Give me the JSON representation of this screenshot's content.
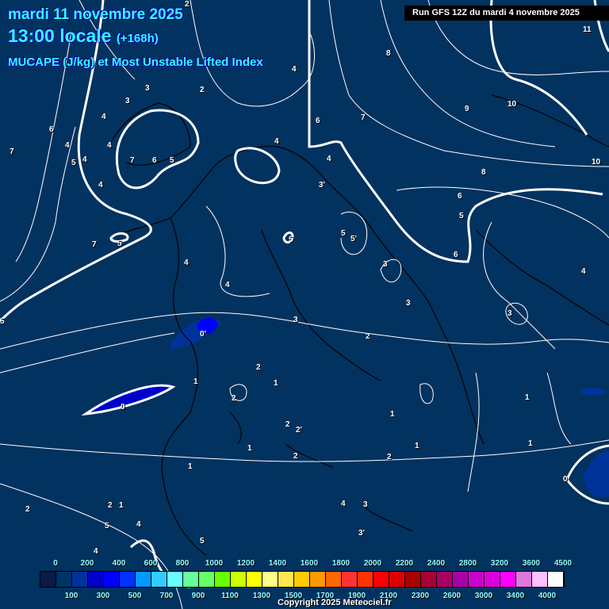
{
  "header": {
    "date": "mardi 11 novembre 2025",
    "time": "13:00 locale",
    "lead": "(+168h)",
    "parameter": "MUCAPE (J/kg) et Most Unstable Lifted Index",
    "run": "Run GFS 12Z du mardi 4 novembre 2025"
  },
  "legend": {
    "top_labels": [
      "0",
      "200",
      "400",
      "600",
      "800",
      "1000",
      "1200",
      "1400",
      "1600",
      "1800",
      "2000",
      "2200",
      "2400",
      "2800",
      "3200",
      "3600",
      "4500"
    ],
    "bottom_labels": [
      "100",
      "300",
      "500",
      "700",
      "900",
      "1100",
      "1300",
      "1500",
      "1700",
      "1900",
      "2100",
      "2300",
      "2600",
      "3000",
      "3400",
      "4000"
    ],
    "colors": [
      "#0a1a44",
      "#003366",
      "#003399",
      "#0000cc",
      "#0000ff",
      "#0033ff",
      "#0099ff",
      "#33ccff",
      "#66ffff",
      "#66ff99",
      "#66ff66",
      "#66ff00",
      "#ccff00",
      "#ffff00",
      "#ffff88",
      "#ffe64d",
      "#ffcc00",
      "#ff9900",
      "#ff6600",
      "#ff3333",
      "#ff3300",
      "#ff0000",
      "#dd0000",
      "#aa0000",
      "#aa0033",
      "#aa0066",
      "#aa00aa",
      "#cc00cc",
      "#dd00dd",
      "#ff00ff",
      "#dd77dd",
      "#ffc0ff",
      "#ffffff"
    ]
  },
  "contour_labels": [
    "2",
    "3",
    "3",
    "2",
    "4",
    "4",
    "4",
    "6",
    "7",
    "7",
    "6",
    "5",
    "5",
    "4",
    "4",
    "7",
    "5",
    "5",
    "4",
    "4",
    "3'",
    "4",
    "6",
    "7",
    "8",
    "9",
    "10",
    "11",
    "10",
    "8",
    "6",
    "5",
    "6",
    "5",
    "5'",
    "5",
    "4",
    "3",
    "3",
    "4",
    "3",
    "3",
    "2",
    "2",
    "1",
    "0'",
    "0",
    "1",
    "2",
    "1",
    "2",
    "2'",
    "1",
    "2",
    "2",
    "1",
    "1",
    "1",
    "1",
    "0",
    "2",
    "4",
    "3",
    "3'",
    "5",
    "4",
    "4",
    "5",
    "2",
    "1",
    "4"
  ],
  "copyright": "Copyright 2025 Meteociel.fr"
}
